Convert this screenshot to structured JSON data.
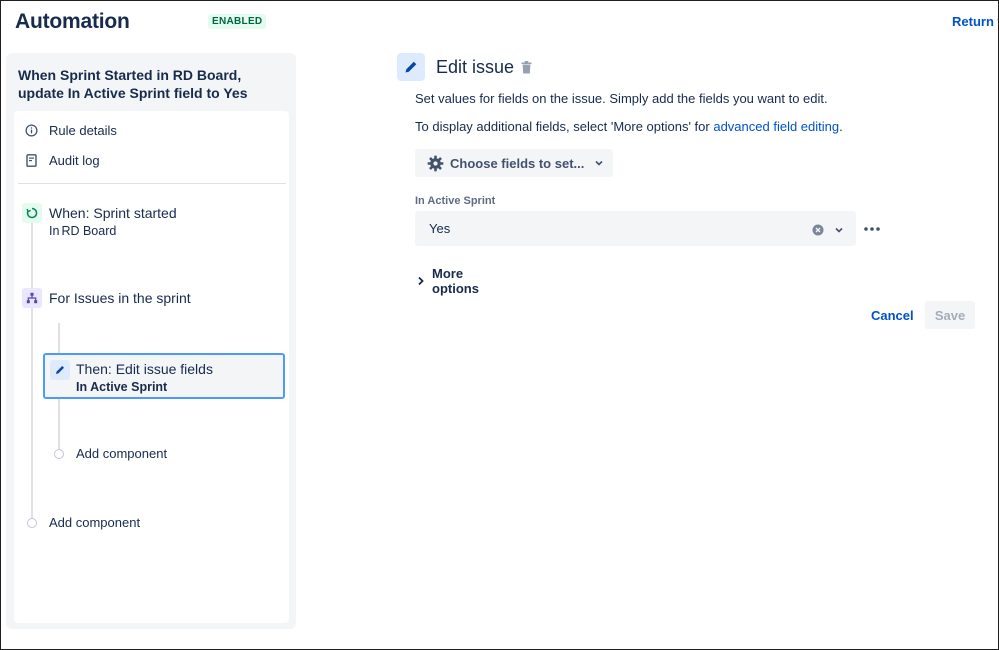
{
  "header": {
    "title": "Automation",
    "status_badge": "ENABLED",
    "return_link": "Return t"
  },
  "sidebar": {
    "rule_name": "When Sprint Started in RD Board, update In Active Sprint field to Yes",
    "nav": [
      {
        "label": "Rule details",
        "icon": "info-icon"
      },
      {
        "label": "Audit log",
        "icon": "document-icon"
      }
    ],
    "components": {
      "trigger": {
        "title": "When: Sprint started",
        "subtitle_prefix": "In",
        "subtitle_value": "RD Board",
        "icon": "trigger-icon"
      },
      "branch": {
        "title": "For Issues in the sprint",
        "icon": "branch-icon"
      },
      "action": {
        "title": "Then: Edit issue fields",
        "subtitle": "In Active Sprint",
        "icon": "pencil-icon"
      },
      "add_component_nested": "Add component",
      "add_component": "Add component"
    },
    "colors": {
      "trigger": "#e3fcef",
      "branch": "#eae6ff",
      "action": "#deebff",
      "selected_border": "#4c9aff"
    }
  },
  "main": {
    "title": "Edit issue",
    "description_1": "Set values for fields on the issue. Simply add the fields you want to edit.",
    "description_2_prefix": "To display additional fields, select 'More options' for ",
    "description_2_link": "advanced field editing",
    "description_2_suffix": ".",
    "choose_fields_label": "Choose fields to set...",
    "field": {
      "label": "In Active Sprint",
      "value": "Yes"
    },
    "more_options_label": "More options",
    "cancel_label": "Cancel",
    "save_label": "Save"
  }
}
